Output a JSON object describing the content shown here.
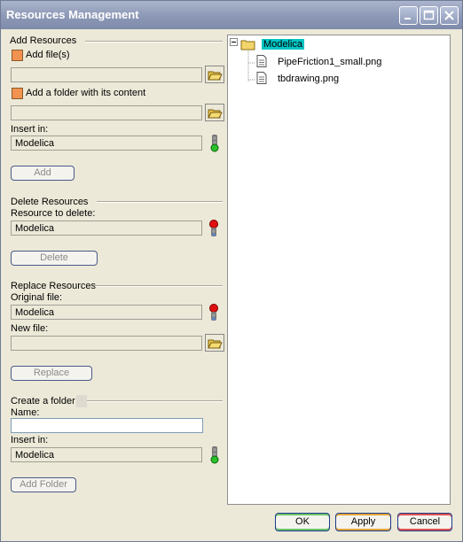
{
  "window": {
    "title": "Resources Management"
  },
  "add": {
    "section": "Add Resources",
    "add_files_label": "Add file(s)",
    "add_files_value": "",
    "add_folder_label": "Add a folder with its content",
    "add_folder_value": "",
    "insert_in_label": "Insert in:",
    "insert_in_value": "Modelica",
    "button": "Add"
  },
  "delete": {
    "section": "Delete Resources",
    "resource_label": "Resource to delete:",
    "resource_value": "Modelica",
    "button": "Delete"
  },
  "replace": {
    "section": "Replace Resources",
    "original_label": "Original file:",
    "original_value": "Modelica",
    "new_label": "New file:",
    "new_value": "",
    "button": "Replace"
  },
  "create": {
    "section": "Create a folder",
    "name_label": "Name:",
    "name_value": "",
    "insert_in_label": "Insert in:",
    "insert_in_value": "Modelica",
    "button": "Add Folder"
  },
  "tree": {
    "root": "Modelica",
    "children": [
      "PipeFriction1_small.png",
      "tbdrawing.png"
    ]
  },
  "footer": {
    "ok": "OK",
    "apply": "Apply",
    "cancel": "Cancel"
  },
  "colors": {
    "accent_checkbox": "#f19250",
    "highlight": "#00c4c4",
    "status_green": "#2bbf2b",
    "status_red": "#e01010"
  }
}
